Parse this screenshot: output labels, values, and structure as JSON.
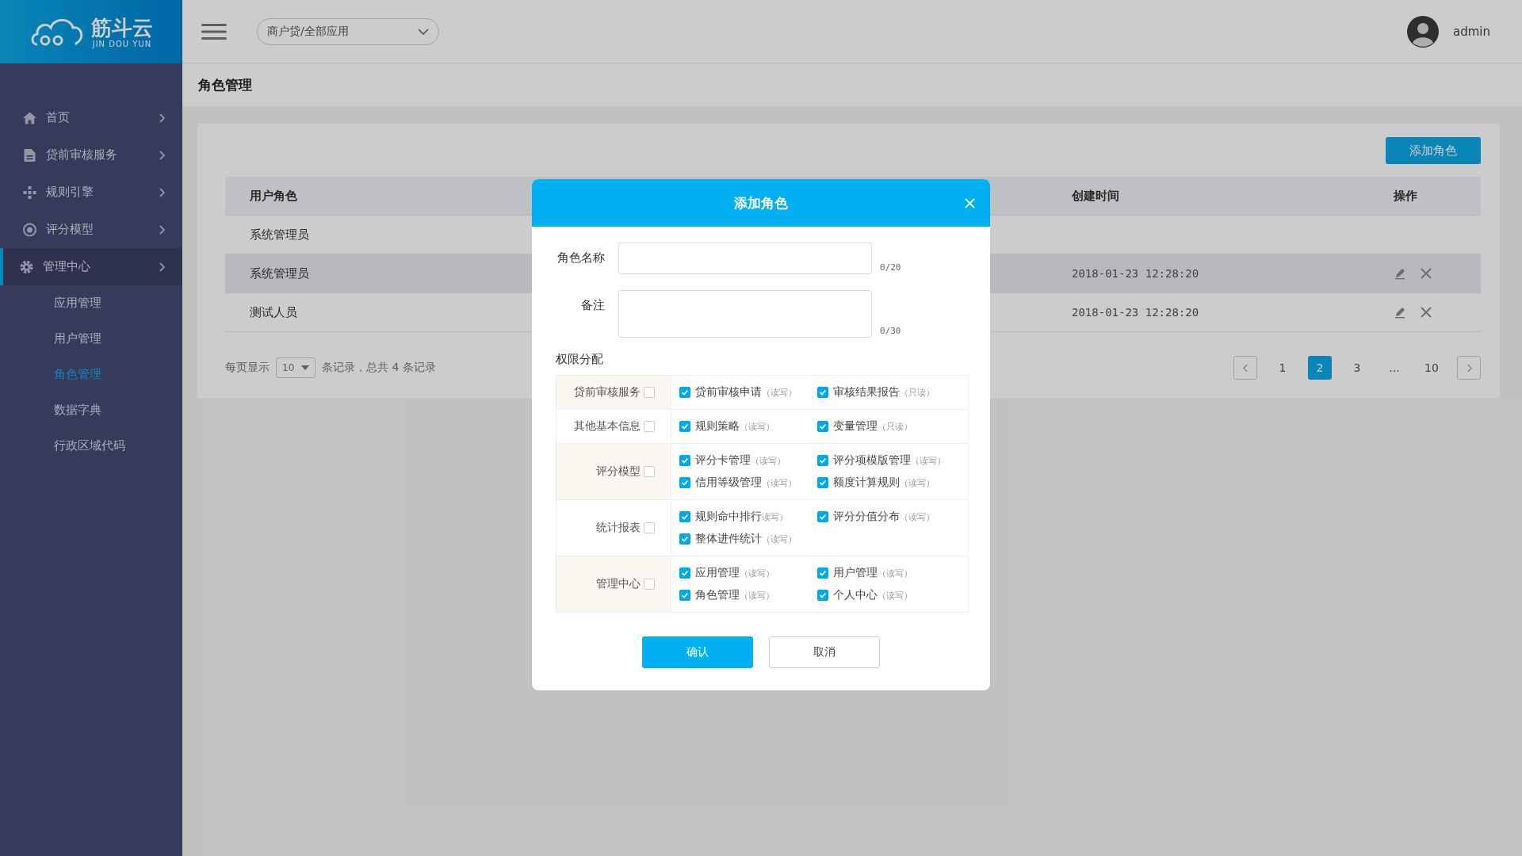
{
  "logo": {
    "name": "筋斗云",
    "subtitle": "JIN DOU YUN"
  },
  "topbar": {
    "app_select": "商户贷/全部应用",
    "user": "admin"
  },
  "sidebar": {
    "items": [
      {
        "label": "首页",
        "expanded": false
      },
      {
        "label": "贷前审核服务",
        "expanded": false
      },
      {
        "label": "规则引擎",
        "expanded": false
      },
      {
        "label": "评分模型",
        "expanded": false
      },
      {
        "label": "管理中心",
        "expanded": true,
        "children": [
          {
            "label": "应用管理",
            "selected": false
          },
          {
            "label": "用户管理",
            "selected": false
          },
          {
            "label": "角色管理",
            "selected": true
          },
          {
            "label": "数据字典",
            "selected": false
          },
          {
            "label": "行政区域代码",
            "selected": false
          }
        ]
      }
    ]
  },
  "page_title": "角色管理",
  "add_button": "添加角色",
  "table": {
    "columns": [
      "用户角色",
      "创建时间",
      "操作"
    ],
    "rows": [
      {
        "role": "系统管理员",
        "selected": false,
        "actions": false
      },
      {
        "role": "系统管理员",
        "created": "2018-01-23 12:28:20",
        "selected": true,
        "actions": true
      },
      {
        "role": "测试人员",
        "created": "2018-01-23 12:28:20",
        "selected": false,
        "actions": true
      }
    ]
  },
  "pagination": {
    "page_size_label": "每页显示",
    "page_size": "10",
    "summary": "条记录，总共 4 条记录",
    "pages": [
      {
        "label": "1",
        "selected": false
      },
      {
        "label": "2",
        "selected": true
      },
      {
        "label": "3",
        "selected": false
      },
      {
        "label": "...",
        "selected": false
      },
      {
        "label": "10",
        "selected": false
      }
    ]
  },
  "dialog": {
    "title": "添加角色",
    "fields": [
      {
        "label": "角色名称",
        "counter": "0/20",
        "kind": "input"
      },
      {
        "label": "备注",
        "counter": "0/30",
        "kind": "textarea"
      }
    ],
    "permissions_label": "权限分配",
    "groups": [
      {
        "name": "贷前审核服务",
        "checked": false,
        "items": [
          {
            "label": "贷前审核申请",
            "note": "（读写）",
            "checked": true
          },
          {
            "label": "审核结果报告",
            "note": "（只读）",
            "checked": true
          }
        ]
      },
      {
        "name": "其他基本信息",
        "checked": false,
        "items": [
          {
            "label": "规则策略",
            "note": "（读写）",
            "checked": true
          },
          {
            "label": "变量管理",
            "note": "（只读）",
            "checked": true
          }
        ]
      },
      {
        "name": "评分模型",
        "checked": false,
        "items": [
          {
            "label": "评分卡管理",
            "note": "（读写）",
            "checked": true
          },
          {
            "label": "评分项模版管理",
            "note": "（读写）",
            "checked": true
          },
          {
            "label": "信用等级管理",
            "note": "（读写）",
            "checked": true
          },
          {
            "label": "额度计算规则",
            "note": "（读写）",
            "checked": true
          }
        ]
      },
      {
        "name": "统计报表",
        "checked": false,
        "items": [
          {
            "label": "规则命中排行",
            "note": "读写）",
            "checked": true
          },
          {
            "label": "评分分值分布",
            "note": "（读写）",
            "checked": true
          },
          {
            "label": "整体进件统计",
            "note": "（读写）",
            "checked": true
          }
        ]
      },
      {
        "name": "管理中心",
        "checked": false,
        "items": [
          {
            "label": "应用管理",
            "note": "（读写）",
            "checked": true
          },
          {
            "label": "用户管理",
            "note": "（读写）",
            "checked": true
          },
          {
            "label": "角色管理",
            "note": "（读写）",
            "checked": true
          },
          {
            "label": "个人中心",
            "note": "（读写）",
            "checked": true
          }
        ]
      }
    ],
    "confirm": "确认",
    "cancel": "取消"
  }
}
